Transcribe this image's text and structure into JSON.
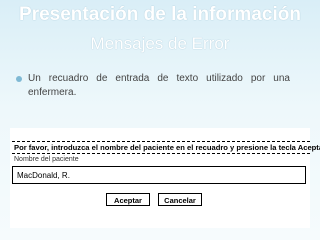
{
  "slide": {
    "title": "Presentación de la información",
    "subtitle": "Mensajes de Error",
    "bullet": "Un recuadro de entrada de texto utilizado por una enfermera."
  },
  "dialog": {
    "prompt": "Por favor, introduzca el nombre del paciente en el recuadro y presione la tecla Aceptar",
    "field_label": "Nombre del paciente",
    "input_value": "MacDonald, R.",
    "ok_label": "Aceptar",
    "cancel_label": "Cancelar"
  },
  "colors": {
    "background": "#d9eef7",
    "title_text": "#ffffff",
    "bullet_marker": "#7fb9d4"
  }
}
